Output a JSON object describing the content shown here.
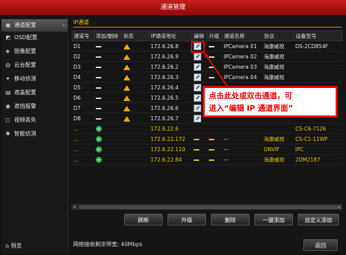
{
  "window": {
    "title": "通道管理"
  },
  "sidebar": {
    "items": [
      {
        "label": "通道配置",
        "icon": "camera-icon",
        "glyph": "▣",
        "active": true
      },
      {
        "label": "OSD配置",
        "icon": "osd-icon",
        "glyph": "◩"
      },
      {
        "label": "图像配置",
        "icon": "image-icon",
        "glyph": "◈"
      },
      {
        "label": "云台配置",
        "icon": "ptz-icon",
        "glyph": "◍"
      },
      {
        "label": "移动侦测",
        "icon": "motion-icon",
        "glyph": "✦"
      },
      {
        "label": "遮盖配置",
        "icon": "mask-icon",
        "glyph": "▤"
      },
      {
        "label": "遮挡报警",
        "icon": "tamper-icon",
        "glyph": "◉"
      },
      {
        "label": "视频丢失",
        "icon": "video-loss-icon",
        "glyph": "◻"
      },
      {
        "label": "智能侦测",
        "icon": "smart-icon",
        "glyph": "✺"
      }
    ],
    "preview_label": "预览"
  },
  "tab": {
    "label": "IP通道"
  },
  "table": {
    "headers": [
      "通道号",
      "添加/删除",
      "状态",
      "IP通道地址",
      "编辑",
      "升级",
      "通道名称",
      "协议",
      "设备型号"
    ],
    "rows": [
      {
        "ch": "D1",
        "ip": "172.6.26.8",
        "name": "IPCamera 01",
        "proto": "海康威视",
        "model": "DS-2CD854F"
      },
      {
        "ch": "D2",
        "ip": "172.6.26.9",
        "name": "IPCamera 02",
        "proto": "海康威视",
        "model": ""
      },
      {
        "ch": "D3",
        "ip": "172.6.26.2",
        "name": "IPCamera 03",
        "proto": "海康威视",
        "model": ""
      },
      {
        "ch": "D4",
        "ip": "172.6.26.3",
        "name": "IPCamera 04",
        "proto": "海康威视",
        "model": ""
      },
      {
        "ch": "D5",
        "ip": "172.6.26.4",
        "name": "",
        "proto": "",
        "model": ""
      },
      {
        "ch": "D6",
        "ip": "172.6.26.5",
        "name": "",
        "proto": "",
        "model": ""
      },
      {
        "ch": "D7",
        "ip": "172.6.26.6",
        "name": "",
        "proto": "",
        "model": ""
      },
      {
        "ch": "D8",
        "ip": "172.6.26.7",
        "name": "",
        "proto": "",
        "model": ""
      }
    ],
    "discovered": [
      {
        "ch": "...",
        "ip": "172.6.22.6",
        "name": "",
        "proto": "",
        "model": "CS-C6-7126"
      },
      {
        "ch": "...",
        "ip": "172.6.22.172",
        "name": "—",
        "proto": "海康威视",
        "model": "CS-C1-11WP"
      },
      {
        "ch": "...",
        "ip": "172.6.22.110",
        "name": "—",
        "proto": "ONVIF",
        "model": "IPC"
      },
      {
        "ch": "...",
        "ip": "172.6.22.84",
        "name": "—",
        "proto": "海康威视",
        "model": "2DM2187"
      }
    ]
  },
  "callout": {
    "line1": "点击此处或双击通道，可",
    "line2": "进入“编辑 IP 通道界面”"
  },
  "buttons": {
    "refresh": "刷新",
    "upgrade": "升级",
    "delete": "删除",
    "one_click_add": "一键添加",
    "custom_add": "自定义添加",
    "back": "返回"
  },
  "footer": {
    "bandwidth": "网络接收剩余带宽: 40Mbps"
  },
  "colors": {
    "title_red": "#c61c1c",
    "highlight_yellow": "#e8c800",
    "warn_orange": "#f0a800",
    "add_green": "#2fa84a",
    "callout_red": "#e00000"
  }
}
